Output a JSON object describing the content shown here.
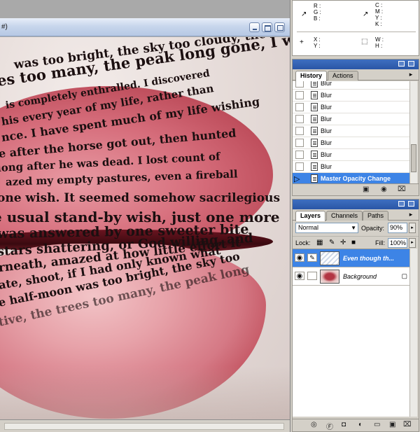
{
  "document": {
    "title": "#)",
    "lip_text_lines": [
      "was too bright, the sky too cloudy, the",
      "es too many, the peak long gone, I was",
      "is completely enthralled. I discovered",
      "his every year of my life, rather than",
      "nce. I have spent much of my life wishing",
      "e after the horse got out, then hunted",
      "long after he was dead. I lost count of",
      "azed my empty pastures, even a fireball",
      "one wish. It seemed somehow sacrilegious",
      "e usual stand-by wish, just one more",
      "was answered by one sweeter bite",
      "stars shattering, or God willing, and",
      "rneath, amazed at how little effort it",
      "ate, shoot, if I had only known what",
      "e half-moon was too bright, the sky too",
      "tive, the trees too many, the peak long"
    ]
  },
  "info": {
    "rgb_labels": "R :\nG :\nB :",
    "cmyk_labels": "C :\nM :\nY :\nK :",
    "xy_labels": "X :\nY :",
    "wh_labels": "W :\nH :"
  },
  "history": {
    "tabs": [
      "History",
      "Actions"
    ],
    "items": [
      {
        "label": "Blur",
        "selected": false
      },
      {
        "label": "Blur",
        "selected": false
      },
      {
        "label": "Blur",
        "selected": false
      },
      {
        "label": "Blur",
        "selected": false
      },
      {
        "label": "Blur",
        "selected": false
      },
      {
        "label": "Blur",
        "selected": false
      },
      {
        "label": "Blur",
        "selected": false
      },
      {
        "label": "Blur",
        "selected": false
      },
      {
        "label": "Master Opacity Change",
        "selected": true
      }
    ]
  },
  "layers": {
    "tabs": [
      "Layers",
      "Channels",
      "Paths"
    ],
    "blend_mode": "Normal",
    "opacity_label": "Opacity:",
    "opacity_value": "90%",
    "lock_label": "Lock:",
    "fill_label": "Fill:",
    "fill_value": "100%",
    "items": [
      {
        "name": "Even though th...",
        "selected": true
      },
      {
        "name": "Background",
        "selected": false
      }
    ]
  },
  "colors": {
    "selection": "#3d84e6",
    "panel_bg": "#d4d0c8",
    "titlebar_accent": "#2a56a6"
  }
}
